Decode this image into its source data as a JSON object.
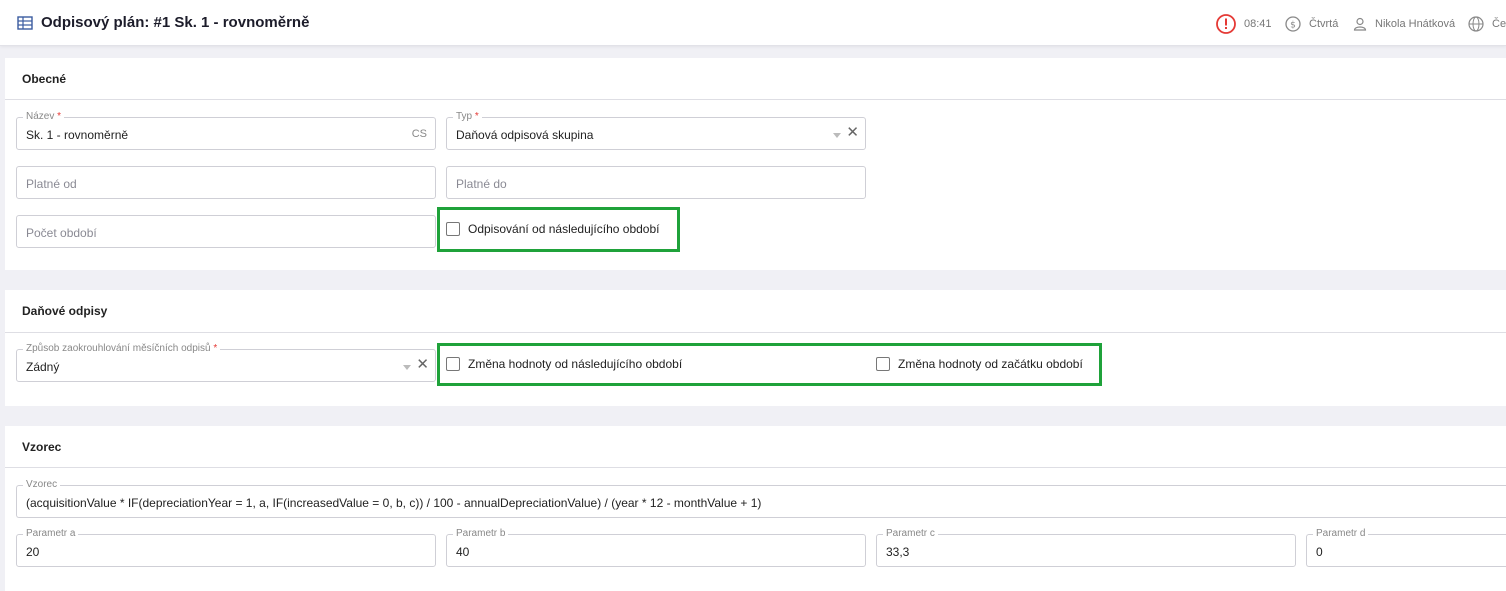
{
  "header": {
    "title": "Odpisový plán: #1 Sk. 1 - rovnoměrně",
    "time": "08:41",
    "company": "Čtvrtá",
    "user": "Nikola Hnátková",
    "language": "Če",
    "alert_color": "#e53935"
  },
  "general": {
    "section_title": "Obecné",
    "name": {
      "label": "Název",
      "required_mark": "*",
      "value": "Sk. 1 - rovnoměrně",
      "lang_suffix": "CS"
    },
    "type": {
      "label": "Typ",
      "required_mark": "*",
      "value": "Daňová odpisová skupina",
      "clear": "✕"
    },
    "valid_from": {
      "placeholder": "Platné od"
    },
    "valid_to": {
      "placeholder": "Platné do"
    },
    "period_count": {
      "placeholder": "Počet období"
    },
    "depreciate_from_next": {
      "label": "Odpisování od následujícího období",
      "checked": false
    }
  },
  "tax": {
    "section_title": "Daňové odpisy",
    "rounding": {
      "label": "Způsob zaokrouhlování měsíčních odpisů",
      "required_mark": "*",
      "value": "Zádný",
      "clear": "✕"
    },
    "change_from_next": {
      "label": "Změna hodnoty od následujícího období",
      "checked": false
    },
    "change_from_start": {
      "label": "Změna hodnoty od začátku období",
      "checked": false
    }
  },
  "formula": {
    "section_title": "Vzorec",
    "formula_field": {
      "label": "Vzorec",
      "value": "(acquisitionValue * IF(depreciationYear = 1, a, IF(increasedValue = 0, b, c)) / 100 - annualDepreciationValue) / (year * 12 - monthValue + 1)"
    },
    "param_a": {
      "label": "Parametr a",
      "value": "20"
    },
    "param_b": {
      "label": "Parametr b",
      "value": "40"
    },
    "param_c": {
      "label": "Parametr c",
      "value": "33,3"
    },
    "param_d": {
      "label": "Parametr d",
      "value": "0"
    }
  },
  "colors": {
    "highlight": "#1fa23a",
    "background": "#f0f0f5",
    "accent": "#3a5ba0"
  }
}
